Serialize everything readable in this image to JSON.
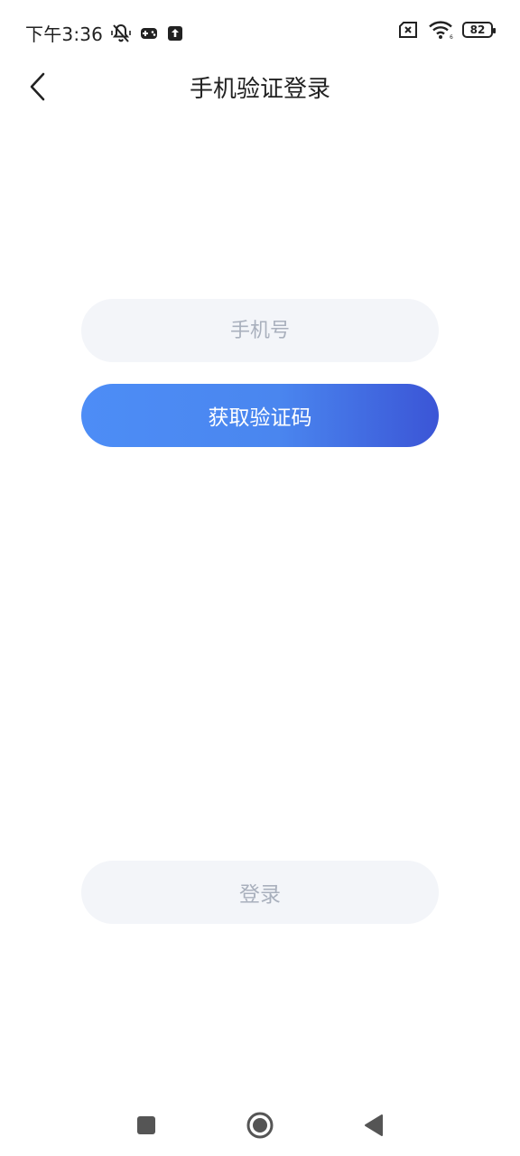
{
  "status_bar": {
    "time": "下午3:36",
    "battery_level": "82",
    "icons": [
      "bell-muted-icon",
      "gamepad-icon",
      "upload-icon",
      "sim-x-icon",
      "wifi-icon",
      "battery-icon"
    ]
  },
  "header": {
    "title": "手机验证登录",
    "back_icon": "chevron-left-icon"
  },
  "form": {
    "phone_placeholder": "手机号",
    "phone_value": "",
    "get_code_label": "获取验证码",
    "login_label": "登录"
  },
  "colors": {
    "accent_start": "#4d8df6",
    "accent_end": "#3b55d6",
    "field_bg": "#f3f5f9",
    "placeholder": "#a9b0bd"
  },
  "system_nav": {
    "buttons": [
      "recents-square-icon",
      "home-circle-icon",
      "back-triangle-icon"
    ]
  }
}
